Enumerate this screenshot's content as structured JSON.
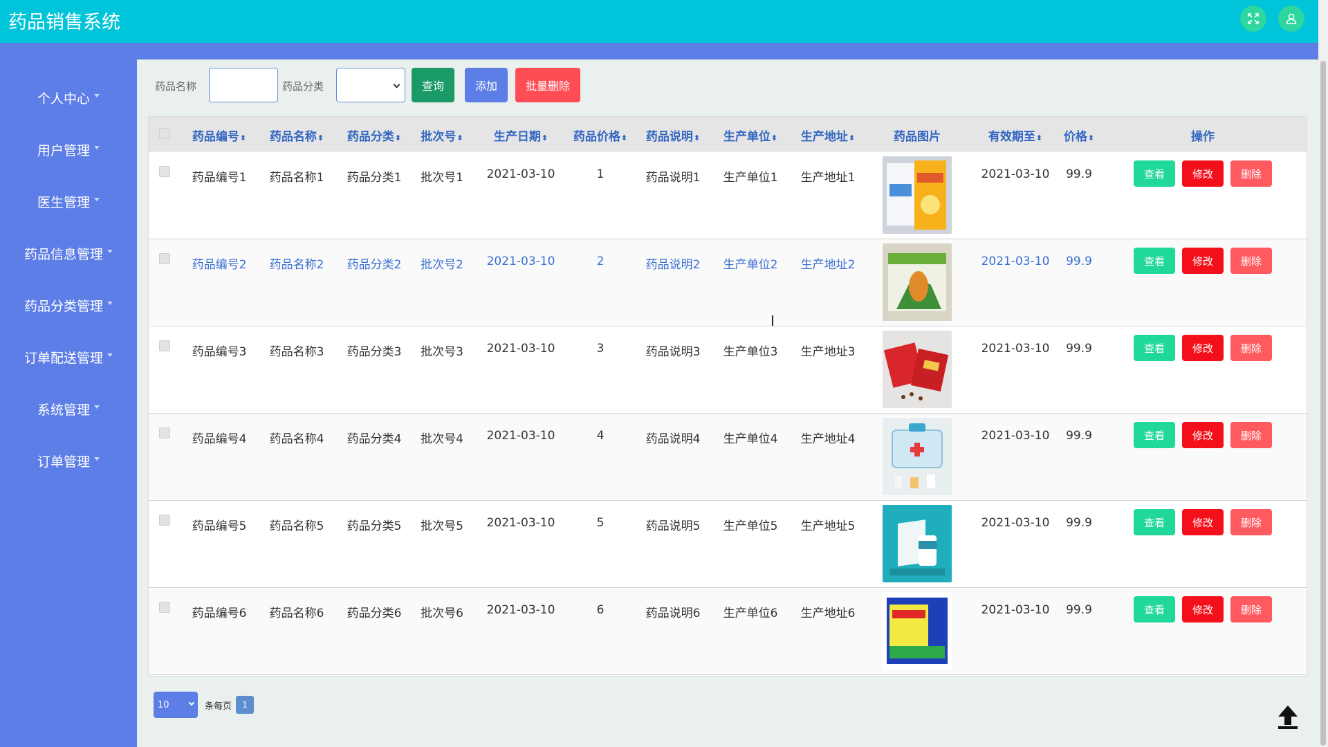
{
  "app": {
    "title": "药品销售系统"
  },
  "header": {
    "fullscreen_icon": "expand-icon",
    "user_icon": "user-icon"
  },
  "sidebar": {
    "items": [
      {
        "label": "个人中心"
      },
      {
        "label": "用户管理"
      },
      {
        "label": "医生管理"
      },
      {
        "label": "药品信息管理"
      },
      {
        "label": "药品分类管理"
      },
      {
        "label": "订单配送管理"
      },
      {
        "label": "系统管理"
      },
      {
        "label": "订单管理"
      }
    ]
  },
  "search": {
    "name_label": "药品名称",
    "name_value": "",
    "category_label": "药品分类",
    "category_value": "",
    "query_button": "查询",
    "add_button": "添加",
    "batch_delete_button": "批量删除"
  },
  "table": {
    "headers": [
      "药品编号",
      "药品名称",
      "药品分类",
      "批次号",
      "生产日期",
      "药品价格",
      "药品说明",
      "生产单位",
      "生产地址",
      "药品图片",
      "有效期至",
      "价格",
      "操作"
    ],
    "rows": [
      {
        "code": "药品编号1",
        "name": "药品名称1",
        "category": "药品分类1",
        "batch": "批次号1",
        "date": "2021-03-10",
        "price": "1",
        "desc": "药品说明1",
        "unit": "生产单位1",
        "address": "生产地址1",
        "expire": "2021-03-10",
        "price2": "99.9"
      },
      {
        "code": "药品编号2",
        "name": "药品名称2",
        "category": "药品分类2",
        "batch": "批次号2",
        "date": "2021-03-10",
        "price": "2",
        "desc": "药品说明2",
        "unit": "生产单位2",
        "address": "生产地址2",
        "expire": "2021-03-10",
        "price2": "99.9"
      },
      {
        "code": "药品编号3",
        "name": "药品名称3",
        "category": "药品分类3",
        "batch": "批次号3",
        "date": "2021-03-10",
        "price": "3",
        "desc": "药品说明3",
        "unit": "生产单位3",
        "address": "生产地址3",
        "expire": "2021-03-10",
        "price2": "99.9"
      },
      {
        "code": "药品编号4",
        "name": "药品名称4",
        "category": "药品分类4",
        "batch": "批次号4",
        "date": "2021-03-10",
        "price": "4",
        "desc": "药品说明4",
        "unit": "生产单位4",
        "address": "生产地址4",
        "expire": "2021-03-10",
        "price2": "99.9"
      },
      {
        "code": "药品编号5",
        "name": "药品名称5",
        "category": "药品分类5",
        "batch": "批次号5",
        "date": "2021-03-10",
        "price": "5",
        "desc": "药品说明5",
        "unit": "生产单位5",
        "address": "生产地址5",
        "expire": "2021-03-10",
        "price2": "99.9"
      },
      {
        "code": "药品编号6",
        "name": "药品名称6",
        "category": "药品分类6",
        "batch": "批次号6",
        "date": "2021-03-10",
        "price": "6",
        "desc": "药品说明6",
        "unit": "生产单位6",
        "address": "生产地址6",
        "expire": "2021-03-10",
        "price2": "99.9"
      }
    ],
    "actions": {
      "view": "查看",
      "edit": "修改",
      "delete": "删除"
    }
  },
  "pagination": {
    "page_size": "10",
    "per_page_label": "条每页",
    "current_page": "1"
  },
  "colors": {
    "header": "#00c4d9",
    "sidebar": "#5c7ee6",
    "view": "#1fd89a",
    "edit": "#f3101a",
    "delete": "#ff5a5f"
  }
}
